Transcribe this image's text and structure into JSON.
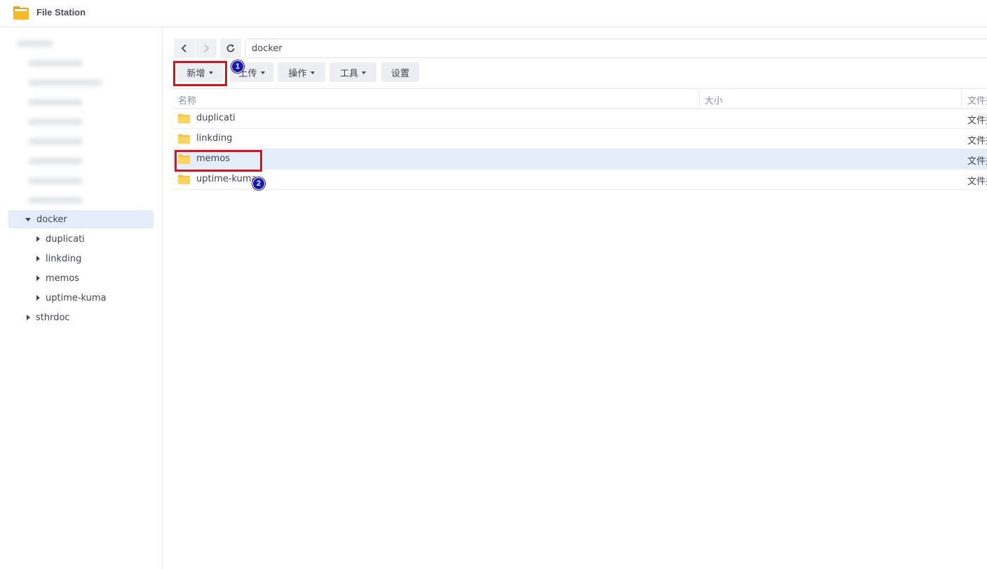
{
  "window": {
    "title": "File Station"
  },
  "sidebar": {
    "tree": [
      {
        "label": "docker",
        "expanded": true,
        "selected": true,
        "level": 0
      },
      {
        "label": "duplicati",
        "expanded": false,
        "level": 1
      },
      {
        "label": "linkding",
        "expanded": false,
        "level": 1
      },
      {
        "label": "memos",
        "expanded": false,
        "level": 1
      },
      {
        "label": "uptime-kuma",
        "expanded": false,
        "level": 1
      },
      {
        "label": "sthrdoc",
        "expanded": false,
        "level": 0
      }
    ]
  },
  "path_bar": {
    "value": "docker"
  },
  "toolbar": {
    "create_label": "新增",
    "upload_label": "上传",
    "action_label": "操作",
    "tools_label": "工具",
    "settings_label": "设置"
  },
  "columns": {
    "name": "名称",
    "size": "大小",
    "type": "文件夹"
  },
  "files": [
    {
      "name": "duplicati",
      "type": "文件夹"
    },
    {
      "name": "linkding",
      "type": "文件夹"
    },
    {
      "name": "memos",
      "type": "文件夹",
      "selected": true
    },
    {
      "name": "uptime-kuma",
      "type": "文件夹"
    }
  ],
  "annotations": {
    "step1": "1",
    "step2": "2"
  },
  "colors": {
    "highlight": "#d9121b",
    "badge": "#1416b8",
    "selection": "#e3edf9",
    "folder": "#f6c445"
  },
  "icons": {
    "app": "folder-app-icon",
    "back": "chevron-left-icon",
    "forward": "chevron-right-icon",
    "refresh": "refresh-icon",
    "folder": "folder-icon"
  }
}
